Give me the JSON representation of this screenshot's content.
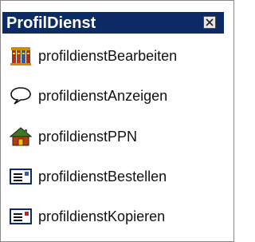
{
  "window": {
    "title": "ProfilDienst",
    "close_icon": "close-icon"
  },
  "colors": {
    "title_bar": "#0c2a63",
    "title_text": "#ffffff"
  },
  "menu": {
    "items": [
      {
        "label": "profildienstBearbeiten",
        "icon": "books-icon"
      },
      {
        "label": "profildienstAnzeigen",
        "icon": "speech-bubble-icon"
      },
      {
        "label": "profildienstPPN",
        "icon": "home-icon"
      },
      {
        "label": "profildienstBestellen",
        "icon": "order-form-icon"
      },
      {
        "label": "profildienstKopieren",
        "icon": "copy-form-icon"
      }
    ]
  }
}
